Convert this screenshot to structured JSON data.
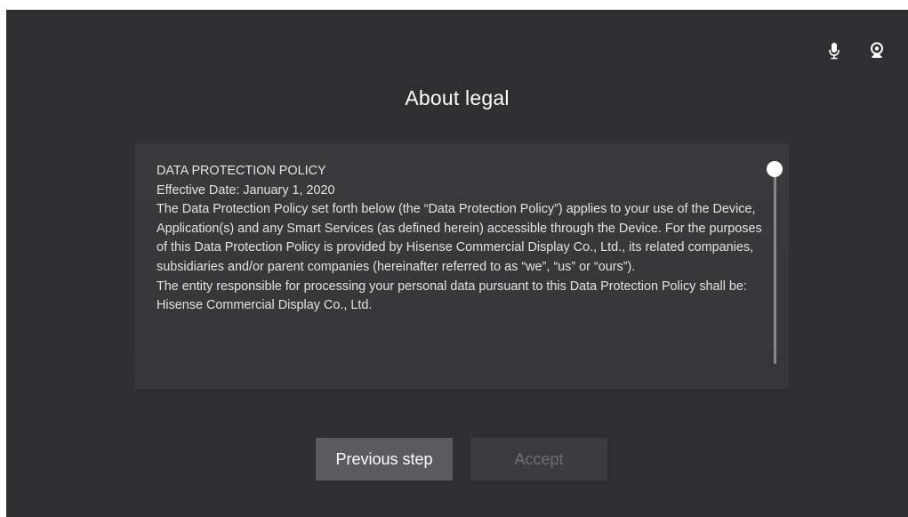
{
  "header": {
    "title": "About legal"
  },
  "icons": {
    "microphone": "microphone-icon",
    "camera": "webcam-icon"
  },
  "policy": {
    "lines": [
      "DATA PROTECTION POLICY",
      "Effective Date: January 1, 2020",
      "The Data Protection Policy set forth below (the “Data Protection Policy”) applies to your use of the Device, Application(s) and any Smart Services (as defined herein) accessible through the Device. For the purposes of this Data Protection Policy is provided by Hisense Commercial Display Co., Ltd., its related companies, subsidiaries and/or parent companies (hereinafter referred to as “we”, “us” or “ours”).",
      "The entity responsible for processing your personal data pursuant to this Data Protection Policy shall be:",
      "Hisense Commercial Display Co., Ltd."
    ]
  },
  "scrollbar": {
    "position": 0
  },
  "buttons": {
    "previous_label": "Previous step",
    "accept_label": "Accept"
  },
  "colors": {
    "background": "#2f2f31",
    "panel": "#3a3a3c",
    "primary_button": "#5b5b5f",
    "disabled_button": "#3c3c3e",
    "disabled_text": "#6f6f71",
    "text": "#ffffff"
  }
}
